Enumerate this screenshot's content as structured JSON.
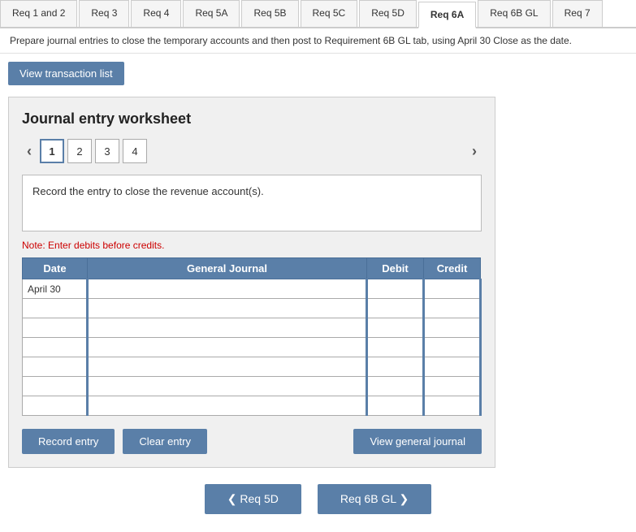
{
  "tabs": [
    {
      "id": "req1and2",
      "label": "Req 1 and 2",
      "active": false
    },
    {
      "id": "req3",
      "label": "Req 3",
      "active": false
    },
    {
      "id": "req4",
      "label": "Req 4",
      "active": false
    },
    {
      "id": "req5a",
      "label": "Req 5A",
      "active": false
    },
    {
      "id": "req5b",
      "label": "Req 5B",
      "active": false
    },
    {
      "id": "req5c",
      "label": "Req 5C",
      "active": false
    },
    {
      "id": "req5d",
      "label": "Req 5D",
      "active": false
    },
    {
      "id": "req6a",
      "label": "Req 6A",
      "active": true
    },
    {
      "id": "req6bgl",
      "label": "Req 6B GL",
      "active": false
    },
    {
      "id": "req7",
      "label": "Req 7",
      "active": false
    }
  ],
  "instruction": "Prepare journal entries to close the temporary accounts and then post to Requirement 6B GL tab, using April 30 Close as the date.",
  "view_transaction_btn": "View transaction list",
  "worksheet": {
    "title": "Journal entry worksheet",
    "pages": [
      {
        "num": "1",
        "active": true
      },
      {
        "num": "2",
        "active": false
      },
      {
        "num": "3",
        "active": false
      },
      {
        "num": "4",
        "active": false
      }
    ],
    "description": "Record the entry to close the revenue account(s).",
    "note": "Note: Enter debits before credits.",
    "table": {
      "headers": {
        "date": "Date",
        "journal": "General Journal",
        "debit": "Debit",
        "credit": "Credit"
      },
      "rows": [
        {
          "date": "April 30",
          "journal": "",
          "debit": "",
          "credit": ""
        },
        {
          "date": "",
          "journal": "",
          "debit": "",
          "credit": ""
        },
        {
          "date": "",
          "journal": "",
          "debit": "",
          "credit": ""
        },
        {
          "date": "",
          "journal": "",
          "debit": "",
          "credit": ""
        },
        {
          "date": "",
          "journal": "",
          "debit": "",
          "credit": ""
        },
        {
          "date": "",
          "journal": "",
          "debit": "",
          "credit": ""
        },
        {
          "date": "",
          "journal": "",
          "debit": "",
          "credit": ""
        }
      ]
    },
    "buttons": {
      "record": "Record entry",
      "clear": "Clear entry",
      "view_journal": "View general journal"
    }
  },
  "bottom_nav": {
    "prev_label": "❮  Req 5D",
    "next_label": "Req 6B GL  ❯"
  }
}
